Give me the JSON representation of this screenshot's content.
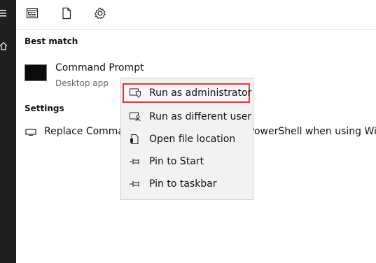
{
  "sections": {
    "best_match": "Best match",
    "settings": "Settings"
  },
  "best_match_item": {
    "name": "Command Prompt",
    "type": "Desktop app",
    "icon": "terminal-icon"
  },
  "settings_item": {
    "text": "Replace Command Prompt with Windows PowerShell when using Windows",
    "icon": "display-icon"
  },
  "context_menu": {
    "items": [
      {
        "label": "Run as administrator",
        "icon": "shield-icon",
        "highlighted": true
      },
      {
        "label": "Run as different user",
        "icon": "user-switch-icon"
      },
      {
        "label": "Open file location",
        "icon": "file-location-icon"
      },
      {
        "label": "Pin to Start",
        "icon": "pin-icon"
      },
      {
        "label": "Pin to taskbar",
        "icon": "pin-icon"
      }
    ]
  },
  "topbar": {
    "icons": [
      "apps-icon",
      "document-icon",
      "settings-icon"
    ]
  },
  "rail": {
    "icons": [
      "hamburger-icon",
      "home-icon"
    ]
  },
  "colors": {
    "rail": "#1f1f1f",
    "menu_bg": "#f2f2f2",
    "highlight_border": "#e53935"
  }
}
